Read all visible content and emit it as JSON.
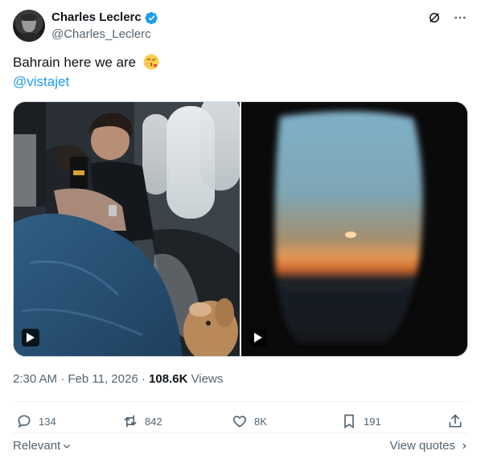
{
  "author": {
    "display_name": "Charles Leclerc",
    "handle": "@Charles_Leclerc",
    "verified": true
  },
  "header_actions": {
    "grok_icon": "grok-icon",
    "more_icon": "more-icon"
  },
  "tweet": {
    "text": "Bahrain here we are",
    "emoji": "face-blowing-a-kiss",
    "mention": "@vistajet"
  },
  "media": [
    {
      "kind": "video",
      "play_icon": "play-icon",
      "subject": "cabin"
    },
    {
      "kind": "video",
      "play_icon": "play-icon",
      "subject": "window-sunset"
    }
  ],
  "meta": {
    "time": "2:30 AM",
    "sep1": "·",
    "date": "Feb 11, 2026",
    "sep2": "·",
    "views_count": "108.6K",
    "views_label": "Views"
  },
  "actions": {
    "replies": "134",
    "reposts": "842",
    "likes": "8K",
    "bookmarks": "191"
  },
  "footer": {
    "sort_label": "Relevant",
    "view_quotes_label": "View quotes"
  },
  "colors": {
    "accent": "#1d9bf0",
    "text": "#0f1419",
    "muted": "#536471",
    "border": "#eff3f4"
  }
}
